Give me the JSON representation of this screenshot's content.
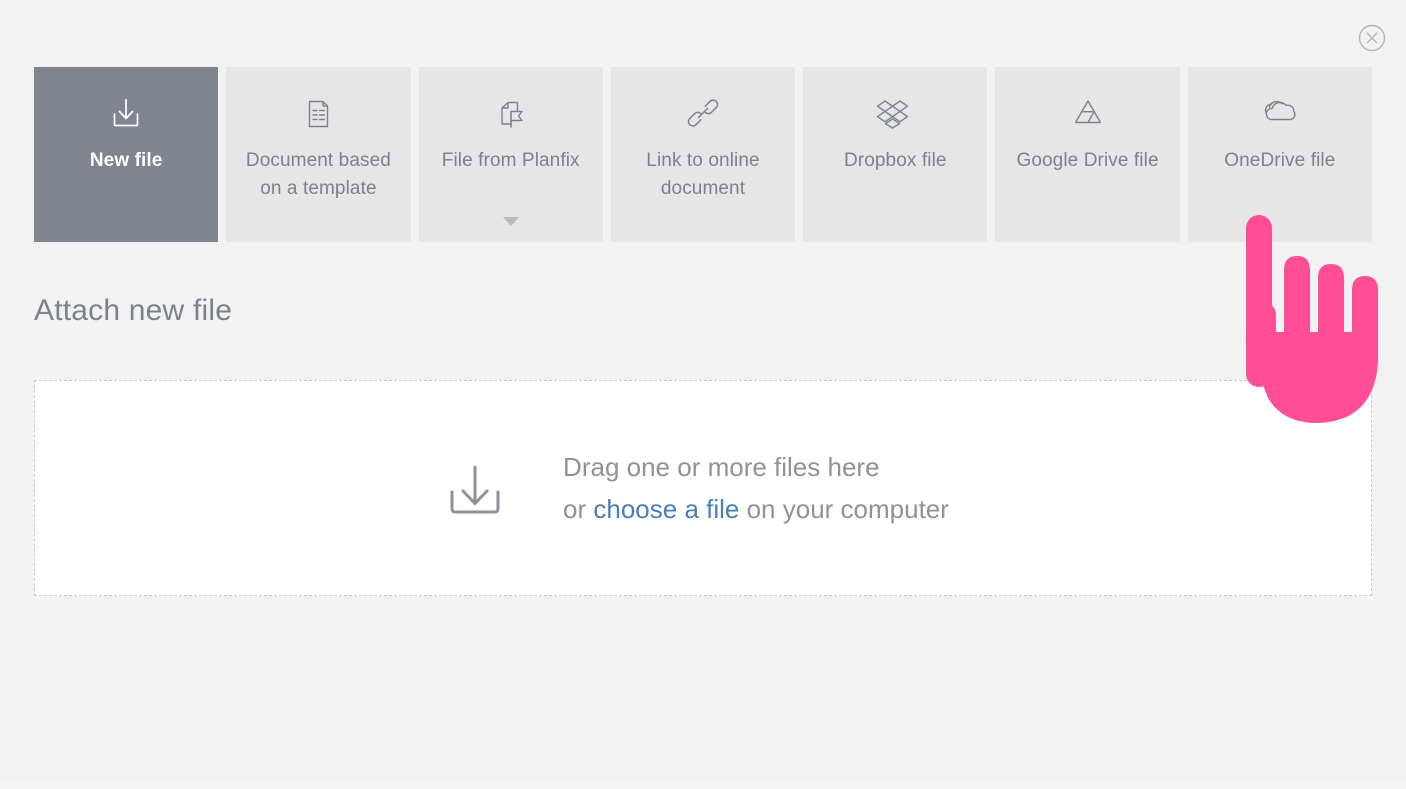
{
  "window": {
    "background_color": "#f2f2f2",
    "close_label": "close"
  },
  "tabs": [
    {
      "id": "new-file",
      "label": "New file",
      "icon": "download-tray-icon",
      "active": true,
      "has_caret": false
    },
    {
      "id": "doc-template",
      "label": "Document based on a template",
      "icon": "document-lines-icon",
      "active": false,
      "has_caret": false
    },
    {
      "id": "file-planfix",
      "label": "File from Planfix",
      "icon": "document-flag-icon",
      "active": false,
      "has_caret": true
    },
    {
      "id": "link-online-doc",
      "label": "Link to online document",
      "icon": "chain-link-icon",
      "active": false,
      "has_caret": false
    },
    {
      "id": "dropbox-file",
      "label": "Dropbox file",
      "icon": "dropbox-icon",
      "active": false,
      "has_caret": false
    },
    {
      "id": "google-drive",
      "label": "Google Drive file",
      "icon": "google-drive-icon",
      "active": false,
      "has_caret": false
    },
    {
      "id": "onedrive-file",
      "label": "OneDrive file",
      "icon": "onedrive-cloud-icon",
      "active": false,
      "has_caret": false
    }
  ],
  "main": {
    "title": "Attach new file",
    "dropzone": {
      "icon": "download-tray-icon",
      "line1": "Drag one or more files here",
      "line2_prefix": "or ",
      "line2_link": "choose a file",
      "line2_suffix": " on your computer"
    }
  },
  "colors": {
    "active_tab": "#7f848f",
    "tab": "#e6e6e6",
    "text_gray": "#7c818c",
    "link_blue": "#4a7ebb",
    "cursor_pink": "#ff4d96",
    "dropzone_border": "#c9c9c9"
  },
  "cursor": {
    "name": "pointing-hand-cursor",
    "color": "#ff4d96"
  }
}
